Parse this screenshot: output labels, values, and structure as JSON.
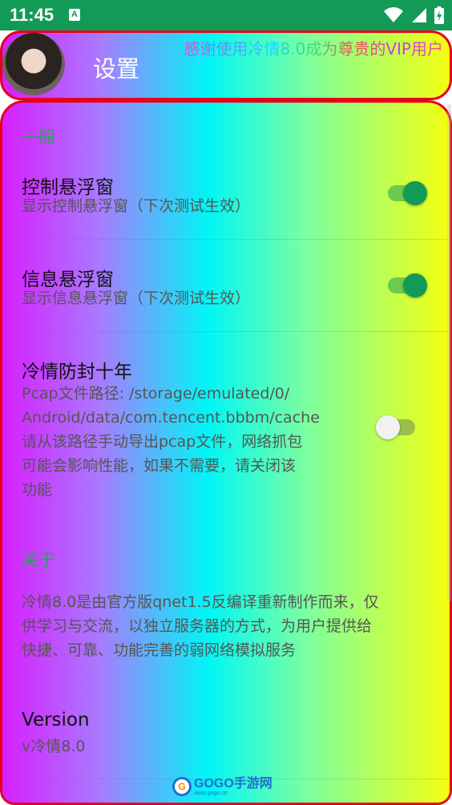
{
  "status_bar": {
    "time": "11:45",
    "notification_letter": "A",
    "icons": [
      "wifi-icon",
      "signal-icon",
      "battery-icon"
    ]
  },
  "header": {
    "title": "设置",
    "vip_banner": "感谢使用冷情8.0成为尊贵的VIP用户"
  },
  "sections": {
    "general": "一般",
    "about": "关于"
  },
  "prefs": {
    "control_float": {
      "title": "控制悬浮窗",
      "summary": "显示控制悬浮窗（下次测试生效）",
      "enabled": true
    },
    "info_float": {
      "title": "信息悬浮窗",
      "summary": "显示信息悬浮窗（下次测试生效）",
      "enabled": true
    },
    "anti_ban": {
      "title": "冷情防封十年",
      "summary_lines": [
        "Pcap文件路径: /storage/emulated/0/",
        "Android/data/com.tencent.bbbm/cache",
        "请从该路径手动导出pcap文件，网络抓包",
        "可能会影响性能，如果不需要，请关闭该",
        "功能"
      ],
      "enabled": false
    },
    "about_text": {
      "summary_lines": [
        "冷情8.0是由官方版qnet1.5反编译重新制作而来，仅",
        "供学习与交流，以独立服务器的方式，为用户提供给",
        "快捷、可靠、功能完善的弱网络模拟服务"
      ]
    },
    "version": {
      "title": "Version",
      "summary": "v冷情8.0"
    }
  },
  "watermark": {
    "text": "GOGO手游网",
    "sub": "www.gogo.cn"
  },
  "colors": {
    "status_bar": "#139a57",
    "accent": "#139a57",
    "border": "#e8001a",
    "section_header": "#27a352"
  }
}
